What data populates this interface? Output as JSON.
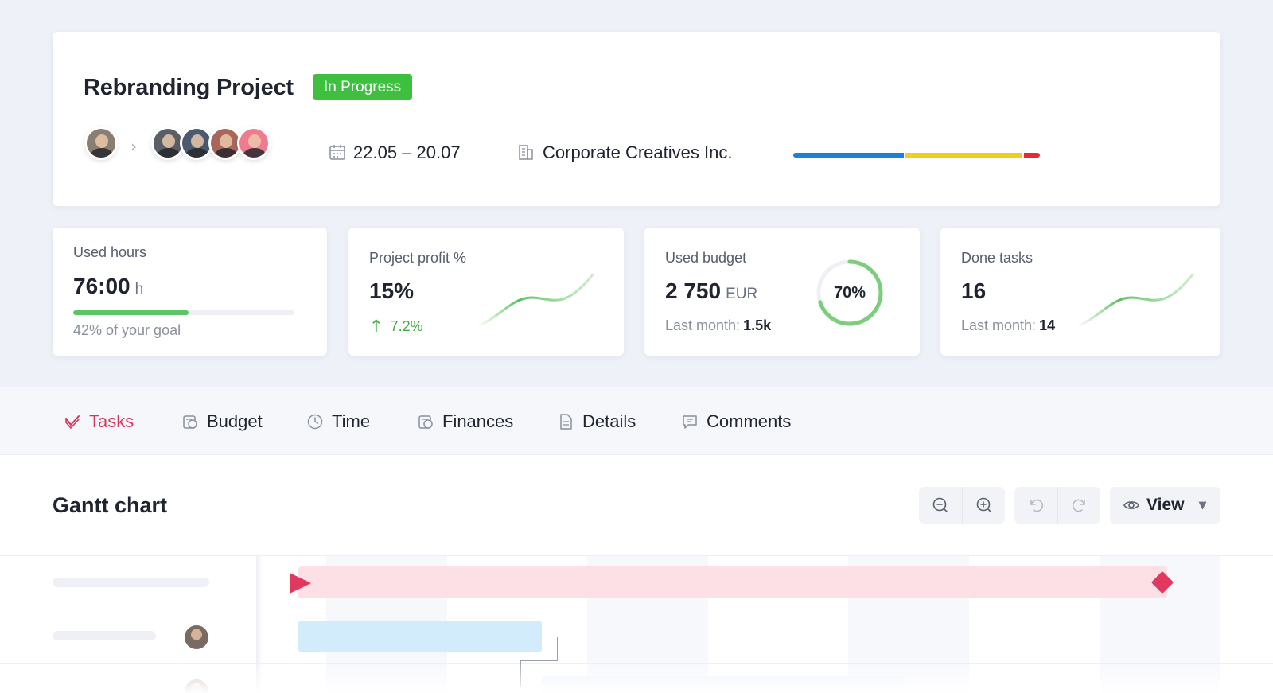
{
  "project": {
    "title": "Rebranding Project",
    "status": "In Progress",
    "status_color": "#3fbf3f",
    "date_range": "22.05 – 20.07",
    "client": "Corporate Creatives Inc.",
    "progress_segments": [
      {
        "color": "#1e7fd6",
        "fraction": 0.455
      },
      {
        "color": "#f2cd1f",
        "fraction": 0.48
      },
      {
        "color": "#e12b3c",
        "fraction": 0.065
      }
    ]
  },
  "stats": {
    "used_hours": {
      "label": "Used hours",
      "value": "76:00",
      "unit": "h",
      "goal_text": "42% of your goal",
      "progress": 0.52
    },
    "profit": {
      "label": "Project profit %",
      "value": "15%",
      "delta": "7.2%"
    },
    "budget": {
      "label": "Used budget",
      "value": "2 750",
      "unit": "EUR",
      "last_month_label": "Last month:",
      "last_month_value": "1.5k",
      "ring_percent": "70%",
      "ring_fraction": 0.7
    },
    "tasks": {
      "label": "Done tasks",
      "value": "16",
      "last_month_label": "Last month:",
      "last_month_value": "14"
    }
  },
  "tabs": [
    {
      "label": "Tasks",
      "active": true
    },
    {
      "label": "Budget",
      "active": false
    },
    {
      "label": "Time",
      "active": false
    },
    {
      "label": "Finances",
      "active": false
    },
    {
      "label": "Details",
      "active": false
    },
    {
      "label": "Comments",
      "active": false
    }
  ],
  "gantt": {
    "title": "Gantt chart",
    "view_label": "View",
    "colors": {
      "milestone": "#e2375e",
      "milestone_bar": "#fde0e6",
      "task_bar": "#d2ecfb"
    }
  }
}
